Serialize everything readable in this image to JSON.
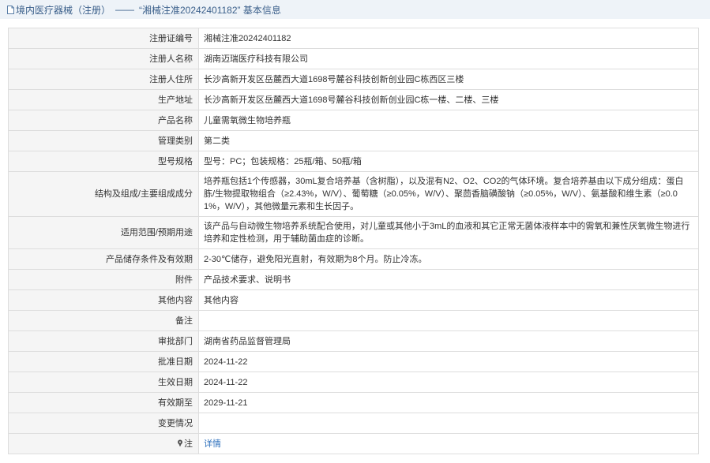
{
  "header": {
    "category": "境内医疗器械（注册）",
    "separator": "——",
    "record_title": "“湘械注准20242401182” 基本信息"
  },
  "rows": [
    {
      "label": "注册证编号",
      "value": "湘械注准20242401182"
    },
    {
      "label": "注册人名称",
      "value": "湖南迈瑞医疗科技有限公司"
    },
    {
      "label": "注册人住所",
      "value": "长沙高新开发区岳麓西大道1698号麓谷科技创新创业园C栋西区三楼"
    },
    {
      "label": "生产地址",
      "value": "长沙高新开发区岳麓西大道1698号麓谷科技创新创业园C栋一楼、二楼、三楼"
    },
    {
      "label": "产品名称",
      "value": "儿童需氧微生物培养瓶"
    },
    {
      "label": "管理类别",
      "value": "第二类"
    },
    {
      "label": "型号规格",
      "value": "型号：PC；包装规格：25瓶/箱、50瓶/箱"
    },
    {
      "label": "结构及组成/主要组成成分",
      "value": "培养瓶包括1个传感器，30mL复合培养基（含树脂），以及混有N2、O2、CO2的气体环境。复合培养基由以下成分组成：蛋白胨/生物提取物组合（≥2.43%，W/V）、葡萄糖（≥0.05%，W/V）、聚茴香脑磺酸钠（≥0.05%，W/V）、氨基酸和维生素（≥0.01%，W/V），其他微量元素和生长因子。"
    },
    {
      "label": "适用范围/预期用途",
      "value": "该产品与自动微生物培养系统配合使用，对儿童或其他小于3mL的血液和其它正常无菌体液样本中的需氧和兼性厌氧微生物进行培养和定性检测，用于辅助菌血症的诊断。"
    },
    {
      "label": "产品储存条件及有效期",
      "value": "2-30℃储存，避免阳光直射，有效期为8个月。防止冷冻。"
    },
    {
      "label": "附件",
      "value": "产品技术要求、说明书"
    },
    {
      "label": "其他内容",
      "value": "其他内容"
    },
    {
      "label": "备注",
      "value": ""
    },
    {
      "label": "审批部门",
      "value": "湖南省药品监督管理局"
    },
    {
      "label": "批准日期",
      "value": "2024-11-22"
    },
    {
      "label": "生效日期",
      "value": "2024-11-22"
    },
    {
      "label": "有效期至",
      "value": "2029-11-21"
    },
    {
      "label": "变更情况",
      "value": ""
    }
  ],
  "note_row": {
    "label": "注",
    "icon": "pin-icon",
    "link_text": "详情"
  },
  "colors": {
    "title_bar_bg": "#eef3f8",
    "title_text": "#3a5f8a",
    "label_bg": "#f5f5f5",
    "border": "#dddddd",
    "link": "#2a6ebb"
  }
}
